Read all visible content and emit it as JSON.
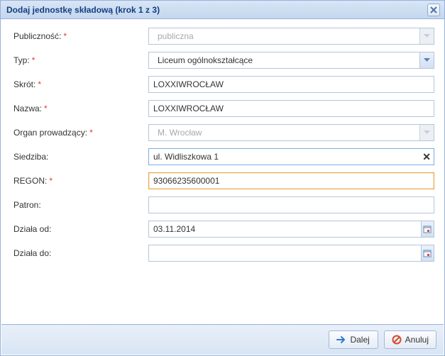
{
  "window": {
    "title": "Dodaj jednostkę składową (krok 1 z 3)"
  },
  "labels": {
    "publicznosc": "Publiczność:",
    "typ": "Typ:",
    "skrot": "Skrót:",
    "nazwa": "Nazwa:",
    "organ": "Organ prowadzący:",
    "siedziba": "Siedziba:",
    "regon": "REGON:",
    "patron": "Patron:",
    "dziala_od": "Działa od:",
    "dziala_do": "Działa do:",
    "req": "*"
  },
  "values": {
    "publicznosc": "publiczna",
    "typ": "Liceum ogólnokształcące",
    "skrot": "LOXXIWROCŁAW",
    "nazwa": "LOXXIWROCŁAW",
    "organ": "M. Wrocław",
    "siedziba": "ul. Widliszkowa 1",
    "regon": "93066235600001",
    "patron": "",
    "dziala_od": "03.11.2014",
    "dziala_do": ""
  },
  "clear_x": "✕",
  "footer": {
    "next": "Dalej",
    "cancel": "Anuluj"
  }
}
